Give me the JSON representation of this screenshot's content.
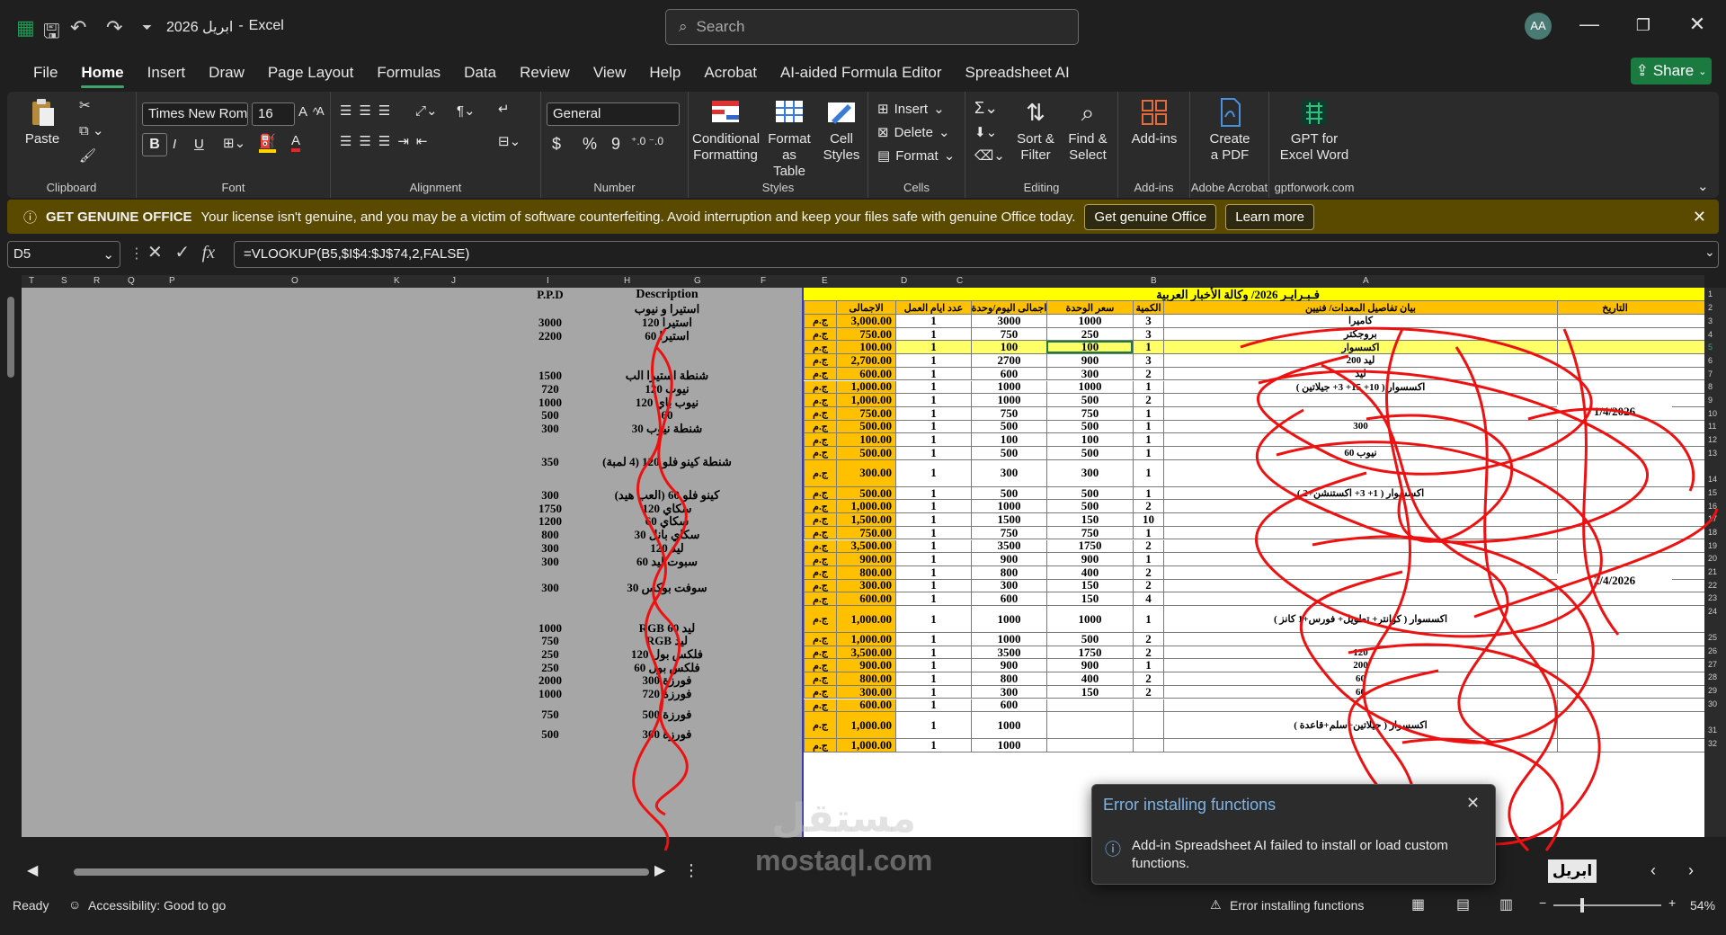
{
  "app": {
    "file_name": "ابريل 2026",
    "separator": "-",
    "app_name": "Excel",
    "user_initials": "AA"
  },
  "search": {
    "placeholder": "Search"
  },
  "tabs": [
    "File",
    "Home",
    "Insert",
    "Draw",
    "Page Layout",
    "Formulas",
    "Data",
    "Review",
    "View",
    "Help",
    "Acrobat",
    "AI-aided Formula Editor",
    "Spreadsheet AI"
  ],
  "share_label": "Share",
  "ribbon": {
    "clipboard": {
      "paste": "Paste",
      "label": "Clipboard"
    },
    "font": {
      "name": "Times New Roman",
      "size": "16",
      "label": "Font",
      "bold": "B",
      "italic": "I",
      "underline": "U"
    },
    "alignment": {
      "label": "Alignment"
    },
    "number": {
      "format": "General",
      "label": "Number",
      "currency": "$",
      "percent": "%",
      "comma": "9"
    },
    "styles": {
      "conditional": [
        "Conditional",
        "Formatting"
      ],
      "format_table": [
        "Format as",
        "Table"
      ],
      "cell_styles": [
        "Cell",
        "Styles"
      ],
      "label": "Styles"
    },
    "cells": {
      "insert": "Insert",
      "delete": "Delete",
      "format": "Format",
      "label": "Cells"
    },
    "editing": {
      "sort": [
        "Sort &",
        "Filter"
      ],
      "find": [
        "Find &",
        "Select"
      ],
      "label": "Editing"
    },
    "addins": {
      "btn": "Add-ins",
      "label": "Add-ins"
    },
    "acrobat": {
      "btn": [
        "Create",
        "a PDF"
      ],
      "label": "Adobe Acrobat"
    },
    "gpt": {
      "btn": [
        "GPT for",
        "Excel Word"
      ],
      "label": "gptforwork.com"
    }
  },
  "banner": {
    "title": "GET GENUINE OFFICE",
    "text": "Your license isn't genuine, and you may be a victim of software counterfeiting. Avoid interruption and keep your files safe with genuine Office today.",
    "btn1": "Get genuine Office",
    "btn2": "Learn more"
  },
  "formula_bar": {
    "cell": "D5",
    "formula": "=VLOOKUP(B5,$I$4:$J$74,2,FALSE)"
  },
  "columns": [
    "T",
    "S",
    "R",
    "Q",
    "P",
    "O",
    "K",
    "J",
    "I",
    "H",
    "G",
    "F",
    "E",
    "D",
    "C",
    "B",
    "A"
  ],
  "left_table": {
    "header": {
      "ppd": "P.P.D",
      "desc": "Description"
    },
    "rows": [
      {
        "ppd": "",
        "desc": "استيرا و نيوب"
      },
      {
        "ppd": "3000",
        "desc": "استيرا 120"
      },
      {
        "ppd": "2200",
        "desc": "استيرا 60"
      },
      {
        "ppd": "",
        "desc": ""
      },
      {
        "ppd": "",
        "desc": ""
      },
      {
        "ppd": "1500",
        "desc": "شنطة استيرا الب"
      },
      {
        "ppd": "720",
        "desc": "نيوب 120"
      },
      {
        "ppd": "1000",
        "desc": "نيوب باي 120"
      },
      {
        "ppd": "500",
        "desc": "60"
      },
      {
        "ppd": "300",
        "desc": "شنطة نيوب 30"
      },
      {
        "ppd": "",
        "desc": ""
      },
      {
        "ppd": "350",
        "desc": "شنطة كينو فلو 120 (4 لمبة)"
      },
      {
        "ppd": "",
        "desc": ""
      },
      {
        "ppd": "300",
        "desc": "كينو فلو 60 (العب هيد)"
      },
      {
        "ppd": "1750",
        "desc": "سكاي 120"
      },
      {
        "ppd": "1200",
        "desc": "سكاي 60"
      },
      {
        "ppd": "800",
        "desc": "سكاي بانل 30"
      },
      {
        "ppd": "300",
        "desc": "ليد 120"
      },
      {
        "ppd": "300",
        "desc": "سبوت ليد 60"
      },
      {
        "ppd": "",
        "desc": ""
      },
      {
        "ppd": "300",
        "desc": "سوفت بوكس 30"
      },
      {
        "ppd": "",
        "desc": ""
      },
      {
        "ppd": "1000",
        "desc": "ليد RGB 60"
      },
      {
        "ppd": "750",
        "desc": "ليد RGB"
      },
      {
        "ppd": "250",
        "desc": "فلكس بول 120"
      },
      {
        "ppd": "250",
        "desc": "فلكس بول 60"
      },
      {
        "ppd": "2000",
        "desc": "فورزة 300"
      },
      {
        "ppd": "1000",
        "desc": "فورزة 720"
      },
      {
        "ppd": "750",
        "desc": "فورزة 500"
      },
      {
        "ppd": "500",
        "desc": "فورزة 300"
      }
    ]
  },
  "right_table": {
    "title": "فـبـرايـر 2026/ وكالة الأخبار العربية",
    "headers": {
      "total": "الاجمالى",
      "days": "عدد ايام العمل",
      "daily": "اجمالى اليوم/وحدة",
      "price": "سعر الوحدة",
      "qty": "الكمية",
      "desc": "بيان تفاصيل المعدات/ فنيين",
      "date": "التاريخ"
    },
    "currency": "ج.م",
    "dates": [
      "1/4/2026",
      "2/4/2026"
    ],
    "rows": [
      {
        "total": "3,000.00",
        "days": "1",
        "daily": "3000",
        "price": "1000",
        "qty": "3",
        "desc": "كاميرا"
      },
      {
        "total": "750.00",
        "days": "1",
        "daily": "750",
        "price": "250",
        "qty": "3",
        "desc": "بروجكتر"
      },
      {
        "total": "100.00",
        "days": "1",
        "daily": "100",
        "price": "100",
        "qty": "1",
        "desc": "اكسسوار"
      },
      {
        "total": "2,700.00",
        "days": "1",
        "daily": "2700",
        "price": "900",
        "qty": "3",
        "desc": "ليد 200"
      },
      {
        "total": "600.00",
        "days": "1",
        "daily": "600",
        "price": "300",
        "qty": "2",
        "desc": "ليد"
      },
      {
        "total": "1,000.00",
        "days": "1",
        "daily": "1000",
        "price": "1000",
        "qty": "1",
        "desc": "اكسسوار ( 10+ 15+ 3+ جيلاتين )"
      },
      {
        "total": "1,000.00",
        "days": "1",
        "daily": "1000",
        "price": "500",
        "qty": "2",
        "desc": ""
      },
      {
        "total": "750.00",
        "days": "1",
        "daily": "750",
        "price": "750",
        "qty": "1",
        "desc": ""
      },
      {
        "total": "500.00",
        "days": "1",
        "daily": "500",
        "price": "500",
        "qty": "1",
        "desc": "300"
      },
      {
        "total": "100.00",
        "days": "1",
        "daily": "100",
        "price": "100",
        "qty": "1",
        "desc": ""
      },
      {
        "total": "500.00",
        "days": "1",
        "daily": "500",
        "price": "500",
        "qty": "1",
        "desc": "نيوب 60"
      },
      {
        "total": "300.00",
        "days": "1",
        "daily": "300",
        "price": "300",
        "qty": "1",
        "desc": ""
      },
      {
        "total": "500.00",
        "days": "1",
        "daily": "500",
        "price": "500",
        "qty": "1",
        "desc": "اكسسوار ( 1+ 3+ اكستنشن+2 )"
      },
      {
        "total": "1,000.00",
        "days": "1",
        "daily": "1000",
        "price": "500",
        "qty": "2",
        "desc": ""
      },
      {
        "total": "1,500.00",
        "days": "1",
        "daily": "1500",
        "price": "150",
        "qty": "10",
        "desc": ""
      },
      {
        "total": "750.00",
        "days": "1",
        "daily": "750",
        "price": "750",
        "qty": "1",
        "desc": ""
      },
      {
        "total": "3,500.00",
        "days": "1",
        "daily": "3500",
        "price": "1750",
        "qty": "2",
        "desc": ""
      },
      {
        "total": "900.00",
        "days": "1",
        "daily": "900",
        "price": "900",
        "qty": "1",
        "desc": ""
      },
      {
        "total": "800.00",
        "days": "1",
        "daily": "800",
        "price": "400",
        "qty": "2",
        "desc": ""
      },
      {
        "total": "300.00",
        "days": "1",
        "daily": "300",
        "price": "150",
        "qty": "2",
        "desc": ""
      },
      {
        "total": "600.00",
        "days": "1",
        "daily": "600",
        "price": "150",
        "qty": "4",
        "desc": ""
      },
      {
        "total": "1,000.00",
        "days": "1",
        "daily": "1000",
        "price": "1000",
        "qty": "1",
        "desc": "اكسسوار ( كوانتر+ تطويل+ فورس+1 كانز )"
      },
      {
        "total": "1,000.00",
        "days": "1",
        "daily": "1000",
        "price": "500",
        "qty": "2",
        "desc": ""
      },
      {
        "total": "3,500.00",
        "days": "1",
        "daily": "3500",
        "price": "1750",
        "qty": "2",
        "desc": "120"
      },
      {
        "total": "900.00",
        "days": "1",
        "daily": "900",
        "price": "900",
        "qty": "1",
        "desc": "200"
      },
      {
        "total": "800.00",
        "days": "1",
        "daily": "800",
        "price": "400",
        "qty": "2",
        "desc": "60"
      },
      {
        "total": "300.00",
        "days": "1",
        "daily": "300",
        "price": "150",
        "qty": "2",
        "desc": "60"
      },
      {
        "total": "600.00",
        "days": "1",
        "daily": "600",
        "price": "",
        "qty": "",
        "desc": ""
      },
      {
        "total": "1,000.00",
        "days": "1",
        "daily": "1000",
        "price": "",
        "qty": "",
        "desc": "اكسسوار ( جيلاتين+سلم+قاعدة )"
      },
      {
        "total": "1,000.00",
        "days": "1",
        "daily": "1000",
        "price": "",
        "qty": "",
        "desc": ""
      }
    ]
  },
  "row_numbers": [
    "1",
    "2",
    "3",
    "4",
    "5",
    "6",
    "7",
    "8",
    "9",
    "10",
    "11",
    "12",
    "13",
    "14",
    "15",
    "16",
    "17",
    "18",
    "19",
    "20",
    "21",
    "22",
    "23",
    "24",
    "25",
    "26",
    "27",
    "28",
    "29",
    "30",
    "31",
    "32"
  ],
  "sheet_tab": "ابريل",
  "status": {
    "ready": "Ready",
    "accessibility": "Accessibility: Good to go",
    "error": "Error installing functions",
    "zoom": "54%"
  },
  "toast": {
    "title": "Error installing functions",
    "message": "Add-in Spreadsheet AI failed to install or load custom functions."
  },
  "watermark": {
    "line1": "مستقل",
    "line2": "mostaql.com"
  },
  "colors": {
    "accent": "#1a7a3f",
    "banner": "#5a4a00",
    "header_yellow": "#ffff00",
    "highlight": "#ffc000",
    "ink_red": "#e11"
  }
}
